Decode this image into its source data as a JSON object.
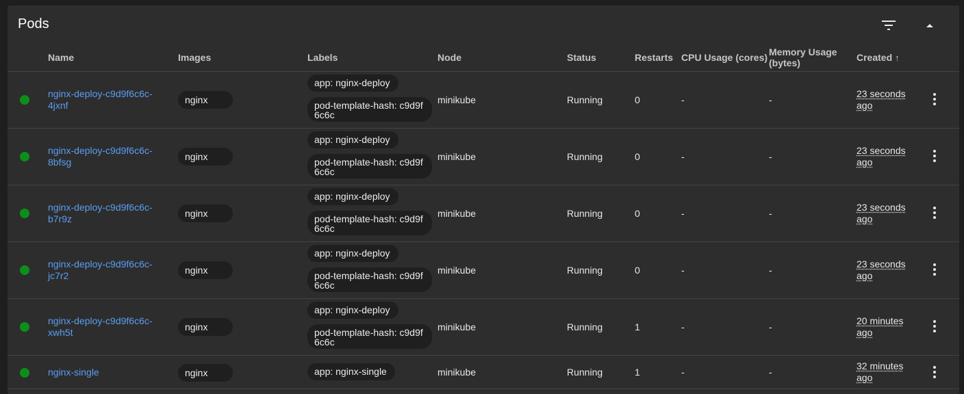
{
  "card": {
    "title": "Pods",
    "filter_icon": "filter-icon",
    "collapse_icon": "chevron-up-icon"
  },
  "columns": {
    "name": "Name",
    "images": "Images",
    "labels": "Labels",
    "node": "Node",
    "status": "Status",
    "restarts": "Restarts",
    "cpu": "CPU Usage (cores)",
    "memory_line1": "Memory Usage",
    "memory_line2": "(bytes)",
    "created": "Created",
    "created_sort": "↑"
  },
  "colors": {
    "status_ok": "#0c8f1a",
    "link": "#5b9df2"
  },
  "pods": [
    {
      "name_line1": "nginx-deploy-c9d9f6c6c-",
      "name_line2": "4jxnf",
      "image": "nginx",
      "label1": "app: nginx-deploy",
      "label2_line1": "pod-template-hash: c9d9f",
      "label2_line2": "6c6c",
      "node": "minikube",
      "status": "Running",
      "restarts": "0",
      "cpu": "-",
      "memory": "-",
      "created_line1": "23 seconds",
      "created_line2": "ago"
    },
    {
      "name_line1": "nginx-deploy-c9d9f6c6c-",
      "name_line2": "8bfsg",
      "image": "nginx",
      "label1": "app: nginx-deploy",
      "label2_line1": "pod-template-hash: c9d9f",
      "label2_line2": "6c6c",
      "node": "minikube",
      "status": "Running",
      "restarts": "0",
      "cpu": "-",
      "memory": "-",
      "created_line1": "23 seconds",
      "created_line2": "ago"
    },
    {
      "name_line1": "nginx-deploy-c9d9f6c6c-",
      "name_line2": "b7r9z",
      "image": "nginx",
      "label1": "app: nginx-deploy",
      "label2_line1": "pod-template-hash: c9d9f",
      "label2_line2": "6c6c",
      "node": "minikube",
      "status": "Running",
      "restarts": "0",
      "cpu": "-",
      "memory": "-",
      "created_line1": "23 seconds",
      "created_line2": "ago"
    },
    {
      "name_line1": "nginx-deploy-c9d9f6c6c-",
      "name_line2": "jc7r2",
      "image": "nginx",
      "label1": "app: nginx-deploy",
      "label2_line1": "pod-template-hash: c9d9f",
      "label2_line2": "6c6c",
      "node": "minikube",
      "status": "Running",
      "restarts": "0",
      "cpu": "-",
      "memory": "-",
      "created_line1": "23 seconds",
      "created_line2": "ago"
    },
    {
      "name_line1": "nginx-deploy-c9d9f6c6c-",
      "name_line2": "xwh5t",
      "image": "nginx",
      "label1": "app: nginx-deploy",
      "label2_line1": "pod-template-hash: c9d9f",
      "label2_line2": "6c6c",
      "node": "minikube",
      "status": "Running",
      "restarts": "1",
      "cpu": "-",
      "memory": "-",
      "created_line1": "20 minutes",
      "created_line2": "ago"
    },
    {
      "name_line1": "nginx-single",
      "name_line2": "",
      "image": "nginx",
      "label1": "app: nginx-single",
      "label2_line1": "",
      "label2_line2": "",
      "node": "minikube",
      "status": "Running",
      "restarts": "1",
      "cpu": "-",
      "memory": "-",
      "created_line1": "32 minutes",
      "created_line2": "ago"
    }
  ]
}
